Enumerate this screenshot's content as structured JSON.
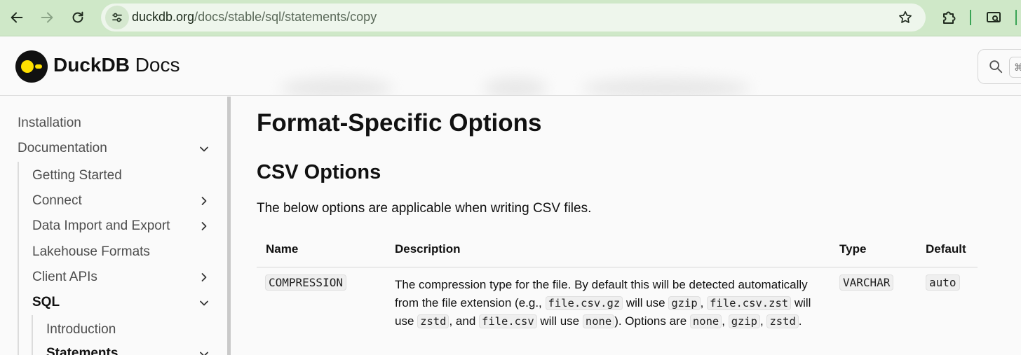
{
  "browser": {
    "url_host": "duckdb.org",
    "url_path": "/docs/stable/sql/statements/copy",
    "icons": {
      "back": "arrow-left-icon",
      "forward": "arrow-right-icon",
      "reload": "reload-icon",
      "site_info": "tune-icon",
      "bookmark": "star-icon",
      "extensions": "puzzle-icon",
      "profile": "cast-search-icon"
    }
  },
  "header": {
    "brand_bold": "DuckDB",
    "brand_rest": " Docs",
    "search_shortcut": "⌘"
  },
  "sidebar": {
    "items": [
      {
        "label": "Installation"
      },
      {
        "label": "Documentation",
        "chevron": "down"
      },
      {
        "label": "Getting Started"
      },
      {
        "label": "Connect",
        "chevron": "right"
      },
      {
        "label": "Data Import and Export",
        "chevron": "right"
      },
      {
        "label": "Lakehouse Formats"
      },
      {
        "label": "Client APIs",
        "chevron": "right"
      },
      {
        "label": "SQL",
        "chevron": "down"
      },
      {
        "label": "Introduction"
      },
      {
        "label": "Statements",
        "chevron": "down"
      }
    ]
  },
  "main": {
    "title": "Format-Specific Options",
    "section": "CSV Options",
    "intro": "The below options are applicable when writing CSV files.",
    "table": {
      "headers": [
        "Name",
        "Description",
        "Type",
        "Default"
      ],
      "rows": [
        {
          "name": "COMPRESSION",
          "desc": {
            "t1": "The compression type for the file. By default this will be detected automatically from the file extension (e.g., ",
            "c1": "file.csv.gz",
            "t2": " will use ",
            "c2": "gzip",
            "t3": ", ",
            "c3": "file.csv.zst",
            "t4": " will use ",
            "c4": "zstd",
            "t5": ", and ",
            "c5": "file.csv",
            "t6": " will use ",
            "c6": "none",
            "t7": "). Options are ",
            "c7": "none",
            "t8": ", ",
            "c8": "gzip",
            "t9": ", ",
            "c9": "zstd",
            "t10": "."
          },
          "type": "VARCHAR",
          "default": "auto"
        }
      ]
    }
  },
  "colors": {
    "chrome": "#cfe8c8",
    "logo_yellow": "#ffe000",
    "logo_black": "#111111"
  }
}
